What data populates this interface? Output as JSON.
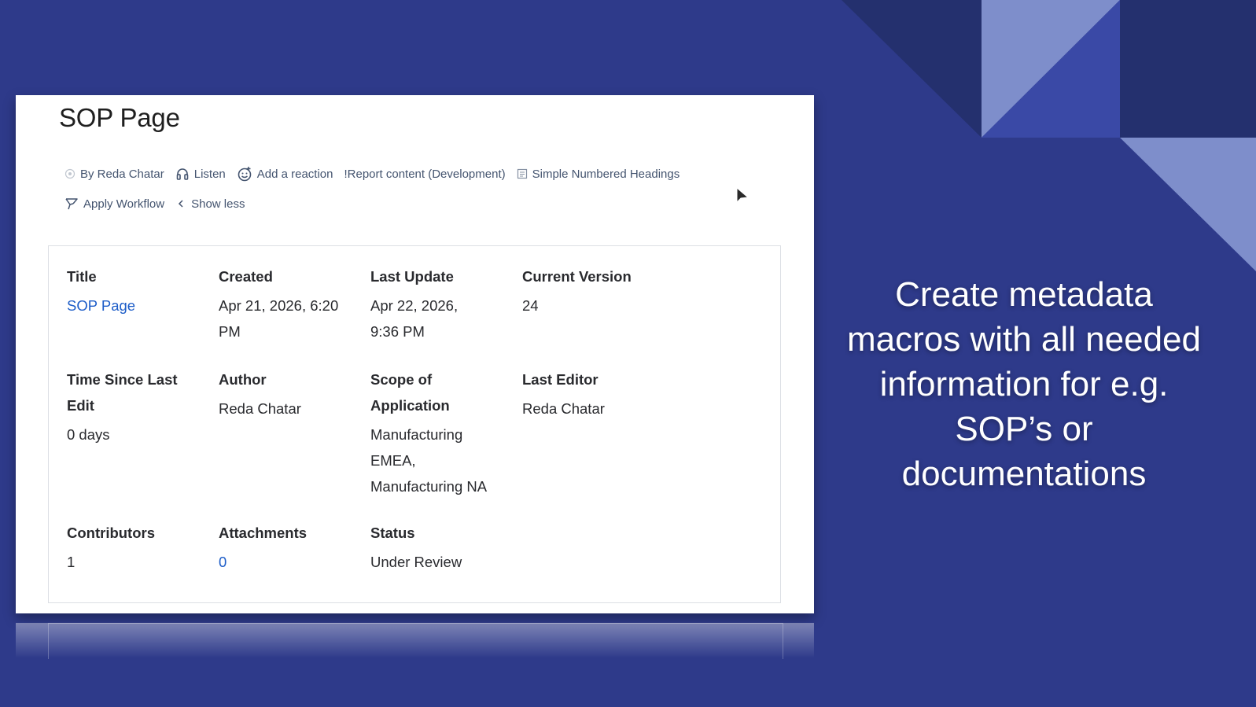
{
  "page": {
    "title": "SOP Page"
  },
  "byline": {
    "author": "By Reda Chatar",
    "listen": "Listen",
    "reaction": "Add a reaction",
    "report": "!Report content (Development)",
    "headings": "Simple Numbered Headings",
    "workflow": "Apply Workflow",
    "show_less": "Show less"
  },
  "metadata": {
    "title_label": "Title",
    "title_value": "SOP Page",
    "created_label": "Created",
    "created_value": "Apr 21, 2026, 6:20 PM",
    "last_update_label": "Last Update",
    "last_update_value": "Apr 22, 2026, 9:36 PM",
    "current_version_label": "Current Version",
    "current_version_value": "24",
    "time_since_label": "Time Since Last Edit",
    "time_since_value": "0 days",
    "author_label": "Author",
    "author_value": "Reda Chatar",
    "scope_label": "Scope of Application",
    "scope_value": "Manufacturing EMEA, Manufacturing NA",
    "last_editor_label": "Last Editor",
    "last_editor_value": "Reda Chatar",
    "contributors_label": "Contributors",
    "contributors_value": "1",
    "attachments_label": "Attachments",
    "attachments_value": "0",
    "status_label": "Status",
    "status_value": "Under Review"
  },
  "slide": {
    "caption": "Create metadata macros with all needed information for e.g. SOP’s or documentations"
  },
  "colors": {
    "background": "#2e3a8a",
    "link": "#1d5dc8",
    "text": "#292a2e"
  }
}
